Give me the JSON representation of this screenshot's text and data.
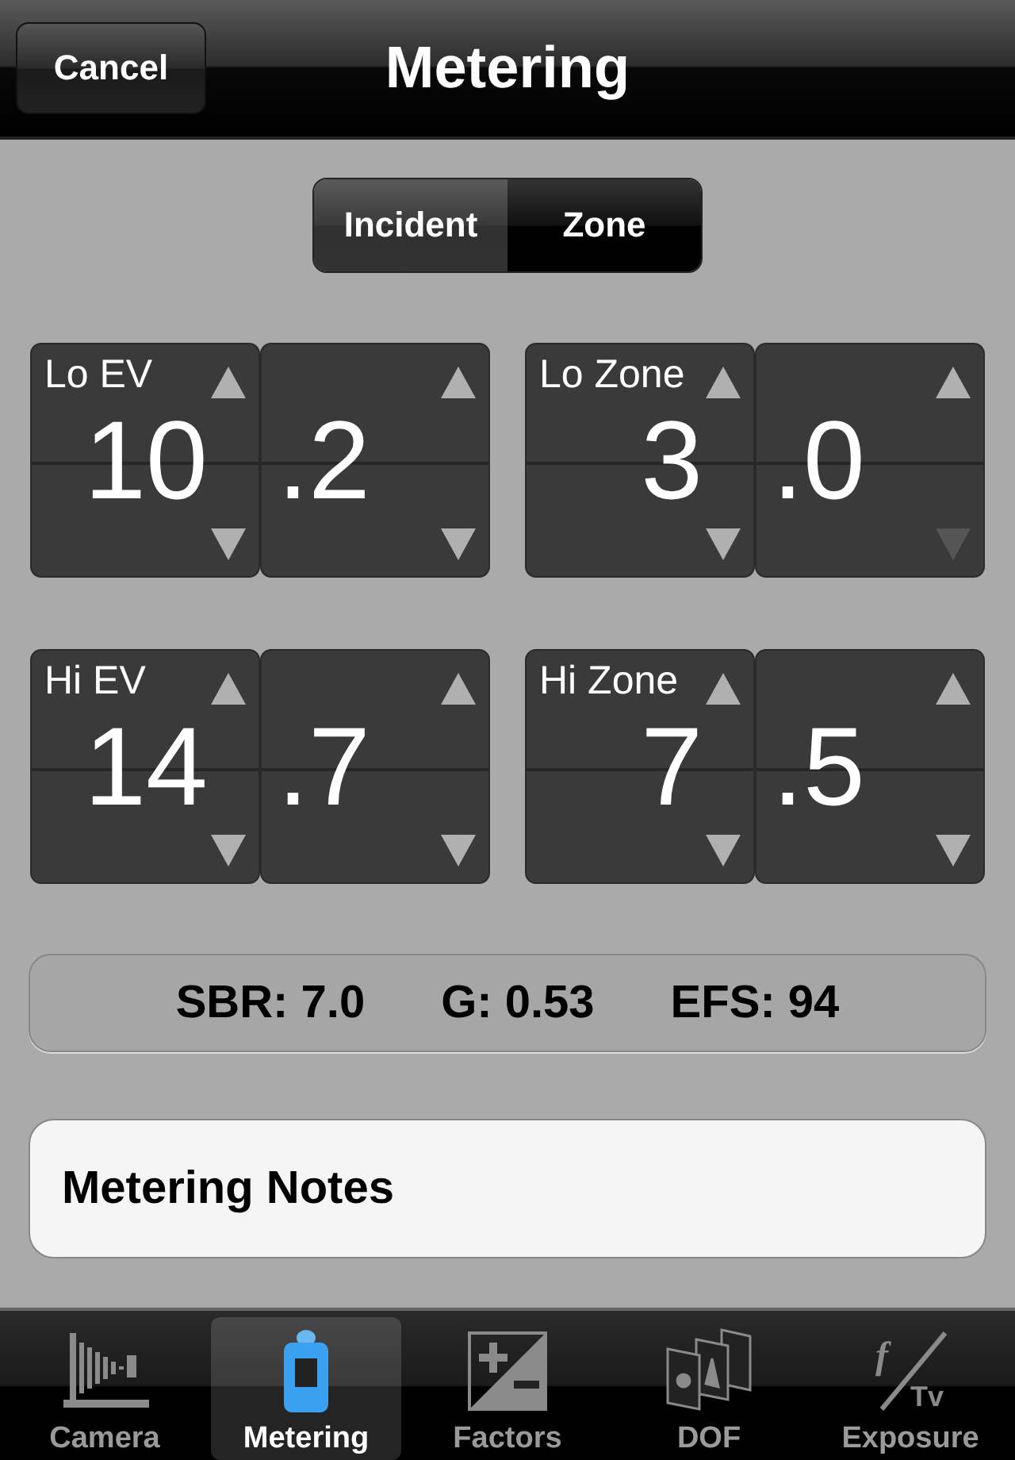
{
  "nav": {
    "cancel": "Cancel",
    "title": "Metering"
  },
  "segments": [
    {
      "label": "Incident",
      "selected": false
    },
    {
      "label": "Zone",
      "selected": true
    }
  ],
  "pickers": [
    {
      "label": "Lo EV",
      "wheels": [
        {
          "value": "10",
          "up_disabled": false,
          "down_disabled": false
        },
        {
          "value": ".2",
          "up_disabled": false,
          "down_disabled": false
        }
      ]
    },
    {
      "label": "Lo Zone",
      "wheels": [
        {
          "value": "3",
          "up_disabled": false,
          "down_disabled": false
        },
        {
          "value": ".0",
          "up_disabled": false,
          "down_disabled": true
        }
      ]
    },
    {
      "label": "Hi EV",
      "wheels": [
        {
          "value": "14",
          "up_disabled": false,
          "down_disabled": false
        },
        {
          "value": ".7",
          "up_disabled": false,
          "down_disabled": false
        }
      ]
    },
    {
      "label": "Hi Zone",
      "wheels": [
        {
          "value": "7",
          "up_disabled": false,
          "down_disabled": false
        },
        {
          "value": ".5",
          "up_disabled": false,
          "down_disabled": false
        }
      ]
    }
  ],
  "readings": [
    "SBR: 7.0",
    "G: 0.53",
    "EFS: 94"
  ],
  "notes": "Metering Notes",
  "tabs": [
    {
      "label": "Camera",
      "kind": "camera",
      "selected": false
    },
    {
      "label": "Metering",
      "kind": "meter",
      "selected": true
    },
    {
      "label": "Factors",
      "kind": "factors",
      "selected": false
    },
    {
      "label": "DOF",
      "kind": "dof",
      "selected": false
    },
    {
      "label": "Exposure",
      "kind": "exposure",
      "marks": [
        "f",
        "Tv"
      ],
      "selected": false
    }
  ]
}
